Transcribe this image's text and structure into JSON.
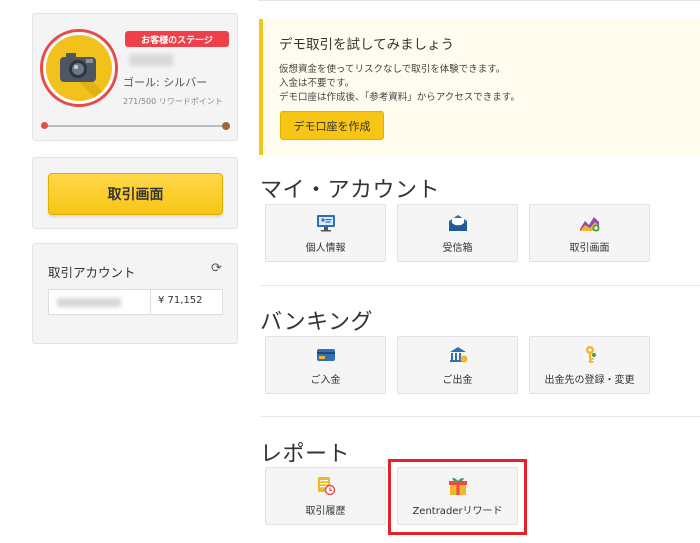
{
  "profile": {
    "stage_badge": "お客様のステージ",
    "goal": "ゴール: シルバー",
    "points": "271/500 リワードポイント",
    "progress_fraction": 0.0,
    "avatar_icon": "camera-icon"
  },
  "trade_button_label": "取引画面",
  "account": {
    "title": "取引アカウント",
    "refresh_icon": "refresh-icon",
    "balance": "¥ 71,152"
  },
  "demo": {
    "title": "デモ取引を試してみましょう",
    "desc_lines": [
      "仮想資金を使ってリスクなしで取引を体験できます。",
      "入金は不要です。",
      "デモ口座は作成後、「参考資料」からアクセスできます。"
    ],
    "button_label": "デモ口座を作成"
  },
  "sections": {
    "my_account": {
      "title": "マイ・アカウント",
      "tiles": [
        {
          "label": "個人情報",
          "icon": "personal-info-icon"
        },
        {
          "label": "受信箱",
          "icon": "inbox-icon"
        },
        {
          "label": "取引画面",
          "icon": "trading-chart-icon"
        }
      ]
    },
    "banking": {
      "title": "バンキング",
      "tiles": [
        {
          "label": "ご入金",
          "icon": "deposit-card-icon"
        },
        {
          "label": "ご出金",
          "icon": "withdraw-bank-icon"
        },
        {
          "label": "出金先の登録・変更",
          "icon": "key-icon"
        }
      ]
    },
    "report": {
      "title": "レポート",
      "tiles": [
        {
          "label": "取引履歴",
          "icon": "history-icon"
        },
        {
          "label": "Zentraderリワード",
          "icon": "gift-icon"
        }
      ]
    }
  },
  "colors": {
    "accent_yellow": "#f7c514",
    "badge_red": "#ef3f4a",
    "highlight_red": "#e3222a"
  }
}
